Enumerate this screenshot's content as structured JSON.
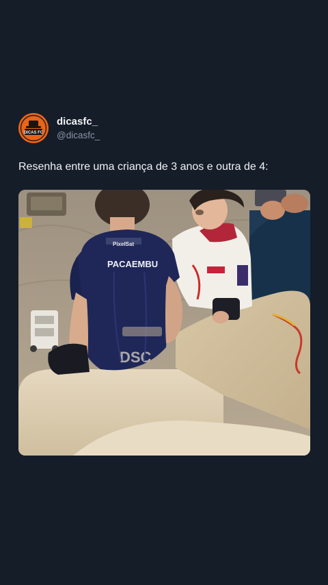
{
  "post": {
    "display_name": "dicasfc_",
    "handle": "@dicasfc_",
    "avatar_text": "DICAS FC",
    "text": "Resenha entre uma criança de 3 anos e outra de 4:"
  },
  "media": {
    "jersey_sponsor": "PACAEMBU",
    "jersey_top_sponsor": "PixelSat",
    "jersey_back_text": "DSC"
  },
  "colors": {
    "background": "#151d29",
    "avatar": "#e8641b",
    "handle": "#8a94a3"
  }
}
